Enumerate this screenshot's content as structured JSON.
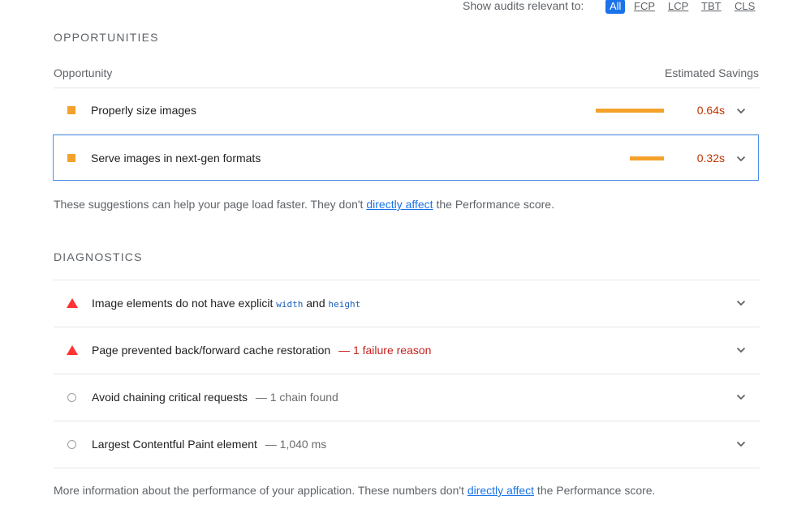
{
  "filter": {
    "label": "Show audits relevant to:",
    "chips": [
      "All",
      "FCP",
      "LCP",
      "TBT",
      "CLS"
    ],
    "active": "All"
  },
  "opportunities": {
    "title": "OPPORTUNITIES",
    "col_left": "Opportunity",
    "col_right": "Estimated Savings",
    "items": [
      {
        "label": "Properly size images",
        "savings": "0.64s",
        "bar_fraction": 1.0
      },
      {
        "label": "Serve images in next-gen formats",
        "savings": "0.32s",
        "bar_fraction": 0.5
      }
    ],
    "note_before": "These suggestions can help your page load faster. They don't ",
    "note_link": "directly affect",
    "note_after": " the Performance score."
  },
  "diagnostics": {
    "title": "DIAGNOSTICS",
    "items": [
      {
        "severity": "fail",
        "icon": "red-triangle-icon",
        "label_a": "Image elements do not have explicit ",
        "code_1": "width",
        "label_b": " and ",
        "code_2": "height"
      },
      {
        "severity": "fail",
        "icon": "red-triangle-icon",
        "label": "Page prevented back/forward cache restoration",
        "sub": "— 1 failure reason"
      },
      {
        "severity": "info",
        "icon": "grey-circle-icon",
        "label": "Avoid chaining critical requests",
        "sub": "— 1 chain found"
      },
      {
        "severity": "info",
        "icon": "grey-circle-icon",
        "label": "Largest Contentful Paint element",
        "sub": "— 1,040 ms"
      }
    ],
    "note_before": "More information about the performance of your application. These numbers don't ",
    "note_link": "directly affect",
    "note_after": " the Performance score."
  },
  "colors": {
    "accent": "#1a73e8",
    "average": "#f4a12b",
    "fail": "#f33",
    "savings_text": "#c33300"
  }
}
